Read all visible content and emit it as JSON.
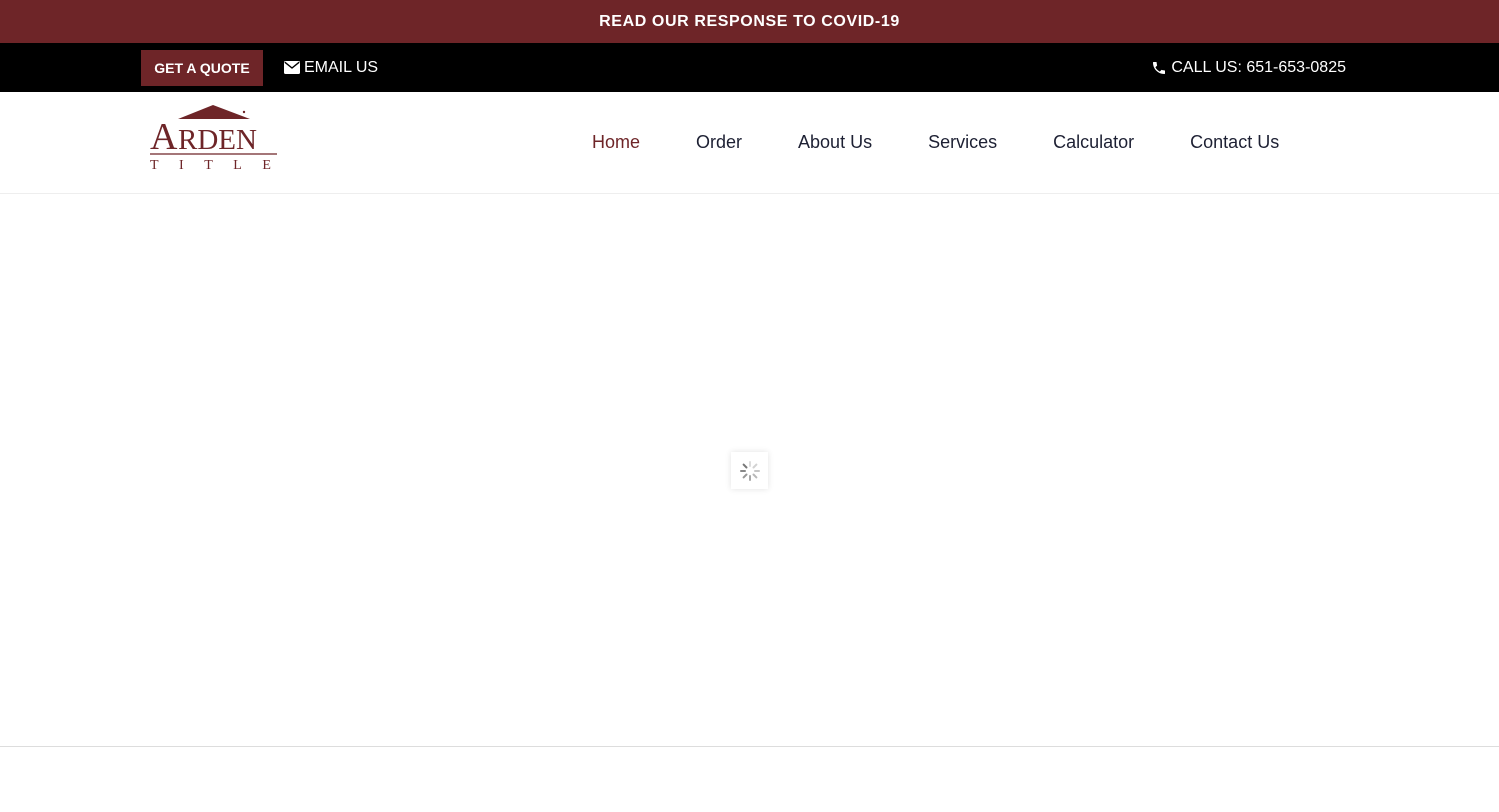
{
  "announcement": {
    "text": "READ OUR RESPONSE TO COVID-19"
  },
  "topbar": {
    "quote_label": "GET A QUOTE",
    "email_label": "EMAIL US",
    "email_icon": "envelope-icon",
    "call_label": "CALL US: 651-653-0825",
    "call_icon": "phone-icon"
  },
  "logo": {
    "brand_word": "ARDEN",
    "sub_word": "TITLE"
  },
  "nav": {
    "items": [
      {
        "label": "Home",
        "active": true
      },
      {
        "label": "Order"
      },
      {
        "label": "About Us"
      },
      {
        "label": "Services"
      },
      {
        "label": "Calculator"
      },
      {
        "label": "Contact Us"
      }
    ]
  },
  "loader": {
    "icon": "spinner-icon"
  },
  "colors": {
    "brand": "#6e2528",
    "topbar": "#000000",
    "nav_text": "#1d2033"
  }
}
